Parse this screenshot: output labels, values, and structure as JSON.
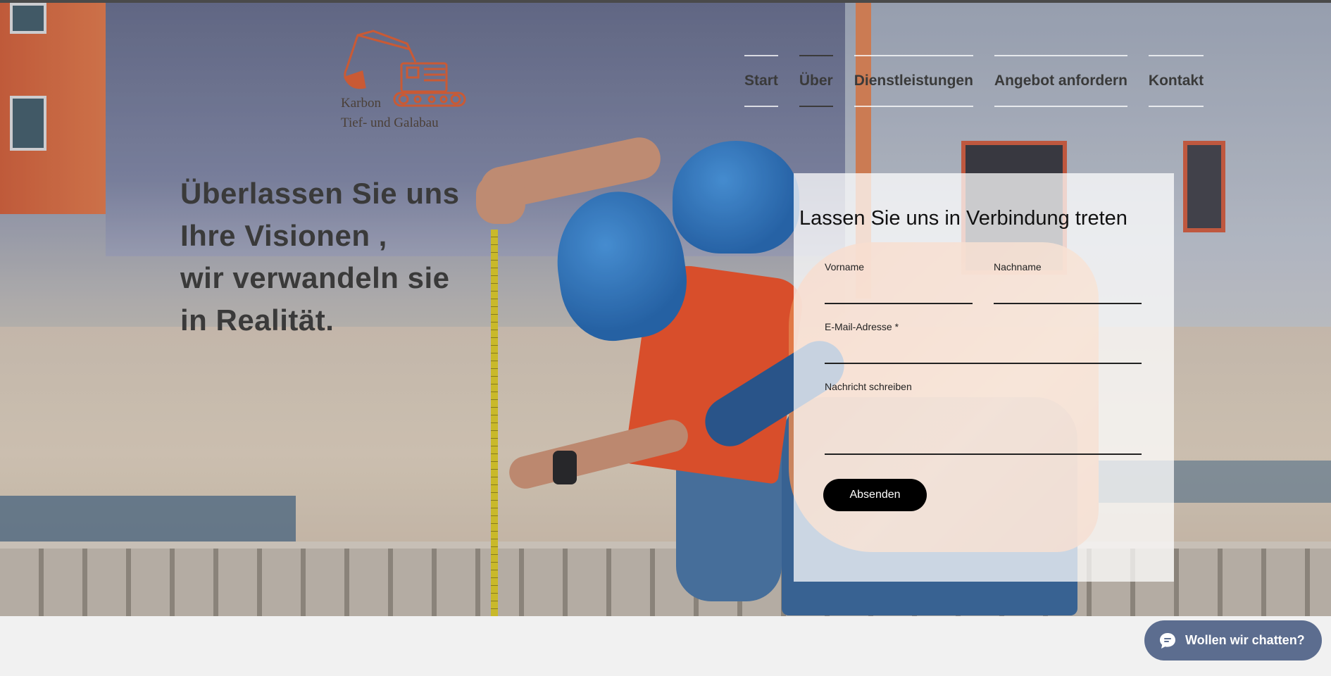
{
  "logo": {
    "line1": "Karbon",
    "line2": "Tief- und Galabau",
    "accent_color": "#c95a35"
  },
  "nav": {
    "items": [
      {
        "label": "Start",
        "active": false
      },
      {
        "label": "Über",
        "active": true
      },
      {
        "label": "Dienstleistungen",
        "active": false
      },
      {
        "label": "Angebot anfordern",
        "active": false
      },
      {
        "label": "Kontakt",
        "active": false
      }
    ]
  },
  "hero": {
    "headline_lines": [
      "Überlassen Sie uns",
      "Ihre Visionen ,",
      "wir verwandeln sie",
      "in Realität."
    ]
  },
  "contact_form": {
    "title": "Lassen Sie uns in Verbindung treten",
    "fields": {
      "first_name_label": "Vorname",
      "last_name_label": "Nachname",
      "email_label": "E-Mail-Adresse *",
      "message_label": "Nachricht schreiben"
    },
    "submit_label": "Absenden"
  },
  "chat": {
    "label": "Wollen wir chatten?",
    "icon": "chat-bubble-icon",
    "color": "#5c6d8f"
  }
}
